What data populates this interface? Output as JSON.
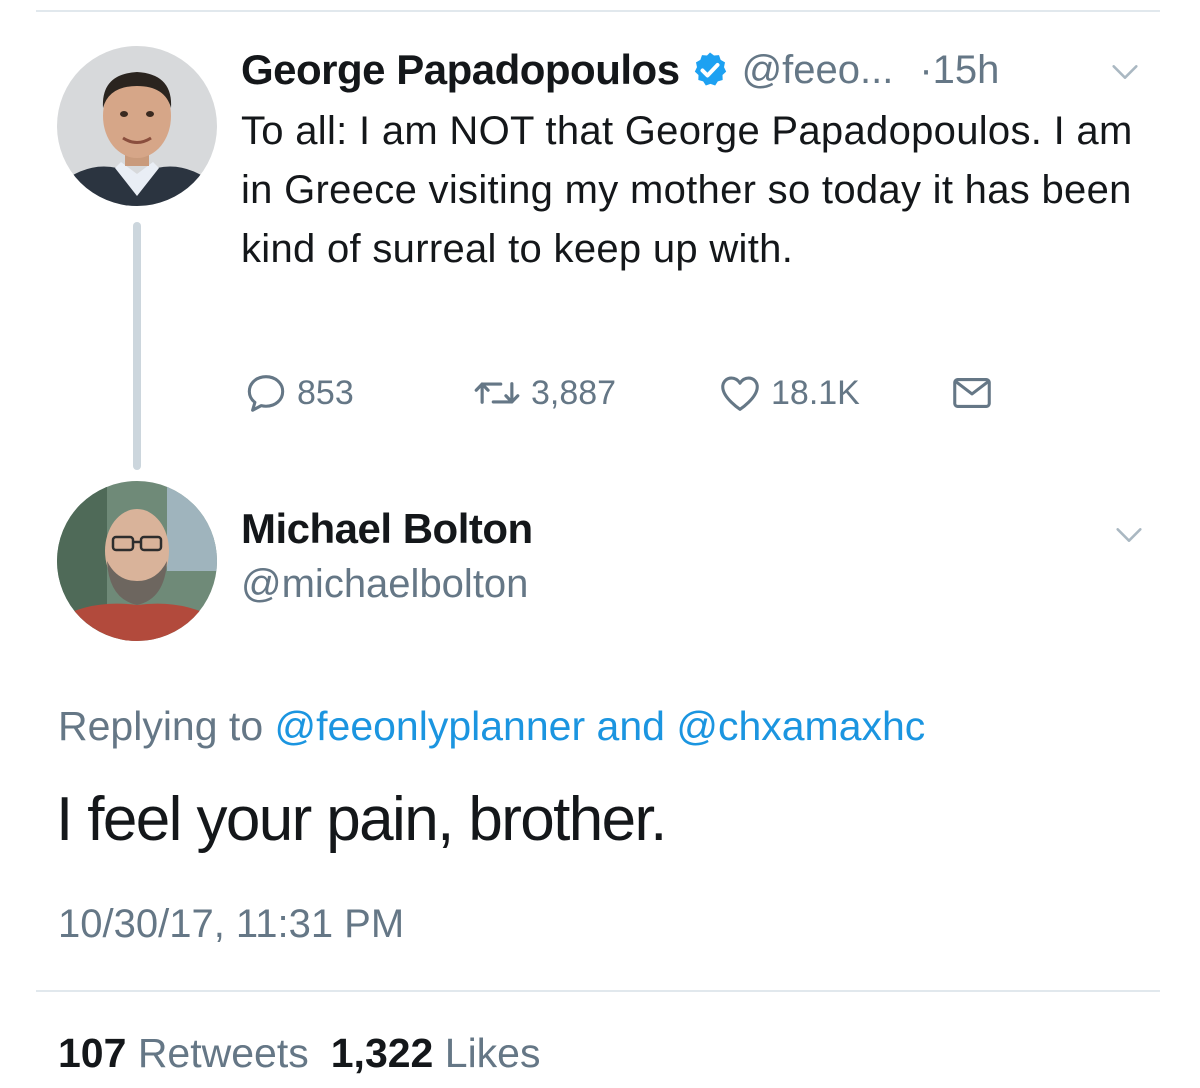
{
  "parent_tweet": {
    "author_name": "George Papadopoulos",
    "handle": "@feeo...",
    "time": "·15h",
    "text": "To all: I am NOT that George Papadopoulos. I am in Greece visiting my mother so today it has been kind of surreal to keep up with.",
    "replies": "853",
    "retweets": "3,887",
    "likes": "18.1K",
    "verified": true,
    "icons": [
      "verified-badge-icon",
      "chevron-down-icon",
      "reply-icon",
      "retweet-icon",
      "heart-icon",
      "direct-message-icon"
    ]
  },
  "reply_tweet": {
    "author_name": "Michael Bolton",
    "handle": "@michaelbolton",
    "replying_prefix": "Replying to ",
    "replying_mention_1": "@feeonlyplanner",
    "replying_and": " and ",
    "replying_mention_2": "@chxamaxhc",
    "text": "I feel your pain, brother.",
    "timestamp": "10/30/17, 11:31 PM",
    "retweet_count": "107",
    "retweet_label": "Retweets",
    "like_count": "1,322",
    "like_label": "Likes"
  },
  "colors": {
    "text_primary": "#14171a",
    "text_secondary": "#657786",
    "link": "#1b95e0",
    "verified": "#1da1f2",
    "divider": "#e1e8ed",
    "thread_line": "#ccd6dd"
  }
}
